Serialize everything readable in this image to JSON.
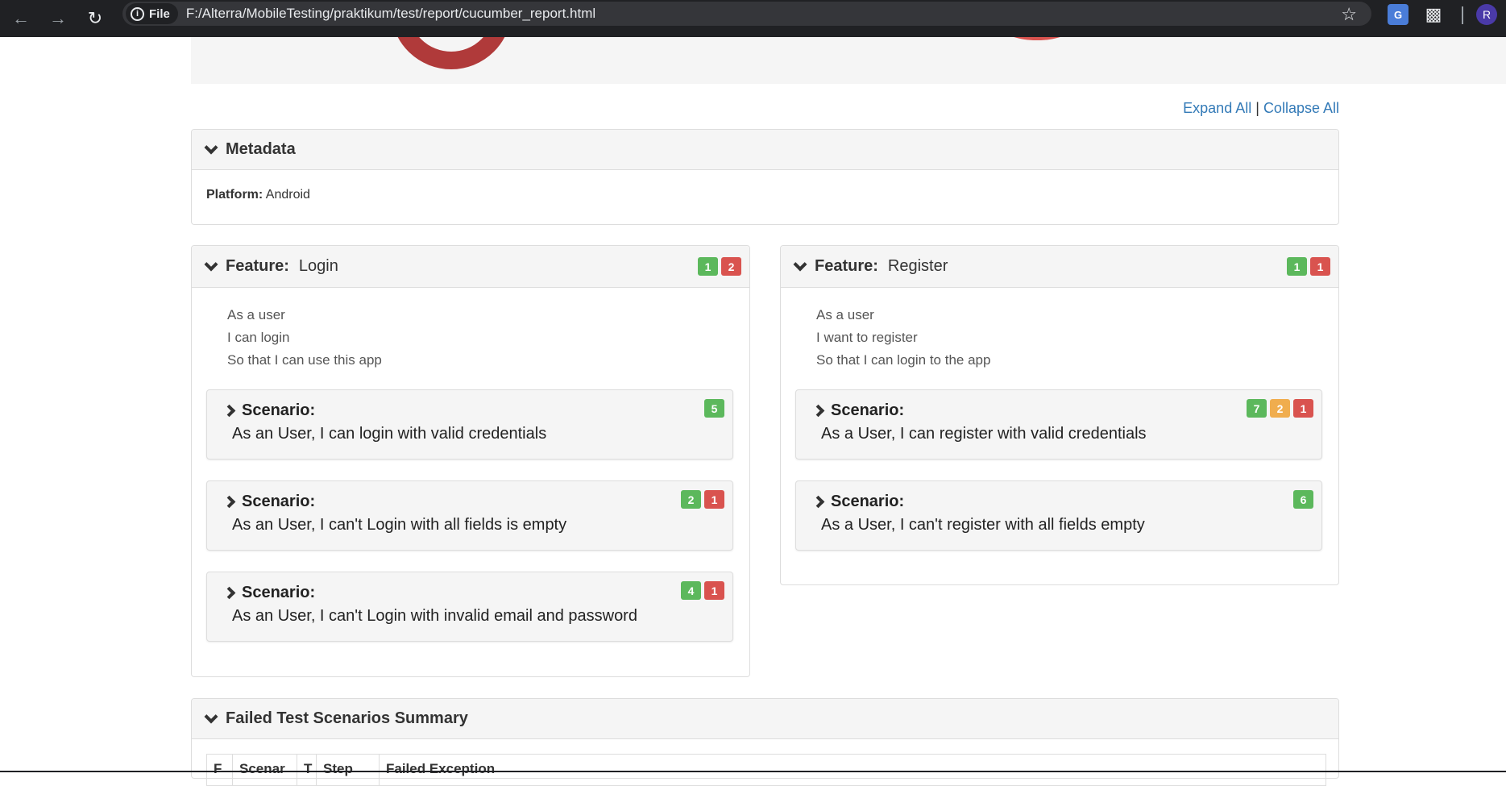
{
  "browser": {
    "file_chip": "File",
    "url": "F:/Alterra/MobileTesting/praktikum/test/report/cucumber_report.html",
    "avatar_letter": "R"
  },
  "links": {
    "expand_all": "Expand All",
    "separator": "|",
    "collapse_all": "Collapse All"
  },
  "metadata": {
    "title": "Metadata",
    "platform_label": "Platform:",
    "platform_value": "Android"
  },
  "features": [
    {
      "label": "Feature:",
      "name": "Login",
      "badges": [
        "1",
        "2"
      ],
      "description": [
        "As a user",
        "I can login",
        "So that I can use this app"
      ],
      "scenarios": [
        {
          "label": "Scenario:",
          "name": "As an User, I can login with valid credentials",
          "badges": [
            "5"
          ]
        },
        {
          "label": "Scenario:",
          "name": "As an User, I can't Login with all fields is empty",
          "badges": [
            "2",
            "1"
          ]
        },
        {
          "label": "Scenario:",
          "name": "As an User, I can't Login with invalid email and password",
          "badges": [
            "4",
            "1"
          ]
        }
      ]
    },
    {
      "label": "Feature:",
      "name": "Register",
      "badges": [
        "1",
        "1"
      ],
      "description": [
        "As a user",
        "I want to register",
        "So that I can login to the app"
      ],
      "scenarios": [
        {
          "label": "Scenario:",
          "name": "As a User, I can register with valid credentials",
          "badges": [
            "7",
            "2",
            "1"
          ]
        },
        {
          "label": "Scenario:",
          "name": "As a User, I can't register with all fields empty",
          "badges": [
            "6"
          ]
        }
      ]
    }
  ],
  "summary": {
    "title": "Failed Test Scenarios Summary",
    "columns": [
      "F",
      "Scenar",
      "T",
      "Step",
      "Failed Exception"
    ]
  },
  "colors": {
    "passed": "#5cb85c",
    "failed": "#d9534f",
    "skipped": "#f0ad4e",
    "link": "#337ab7"
  }
}
